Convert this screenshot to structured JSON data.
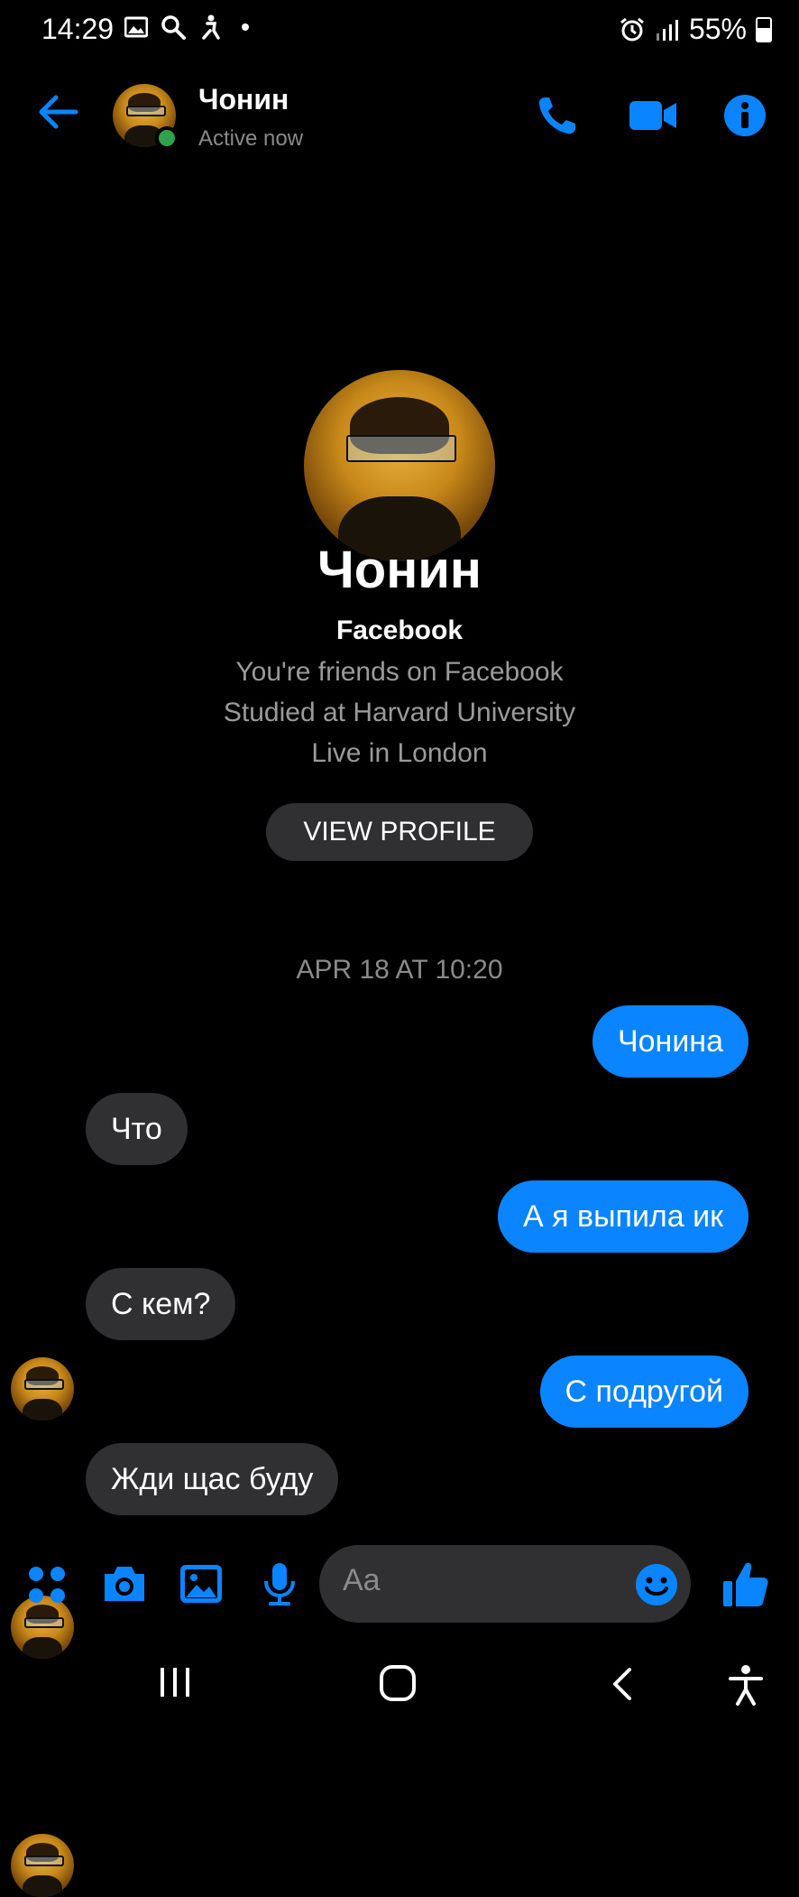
{
  "status_bar": {
    "time": "14:29",
    "battery": "55%"
  },
  "header": {
    "name": "Чонин",
    "status": "Active now"
  },
  "profile": {
    "name": "Чонин",
    "source": "Facebook",
    "lines": [
      "You're friends on Facebook",
      "Studied at Harvard University",
      "Live in London"
    ],
    "view_profile_label": "VIEW PROFILE"
  },
  "conversation": {
    "date_separator": "APR 18 AT 10:20",
    "messages": [
      {
        "direction": "out",
        "text": "Чонина"
      },
      {
        "direction": "in",
        "text": "Что"
      },
      {
        "direction": "out",
        "text": "А я выпила ик"
      },
      {
        "direction": "in",
        "text": "С кем?"
      },
      {
        "direction": "out",
        "text": "С подругой"
      },
      {
        "direction": "in",
        "text": "Жди щас буду"
      }
    ]
  },
  "composer": {
    "placeholder": "Aa"
  },
  "colors": {
    "accent": "#0a84ff",
    "bubble_in": "#303033",
    "background": "#000000"
  },
  "icons": [
    "back-arrow-icon",
    "phone-icon",
    "video-camera-icon",
    "info-icon",
    "apps-grid-icon",
    "camera-icon",
    "gallery-icon",
    "microphone-icon",
    "emoji-icon",
    "thumbs-up-icon"
  ]
}
